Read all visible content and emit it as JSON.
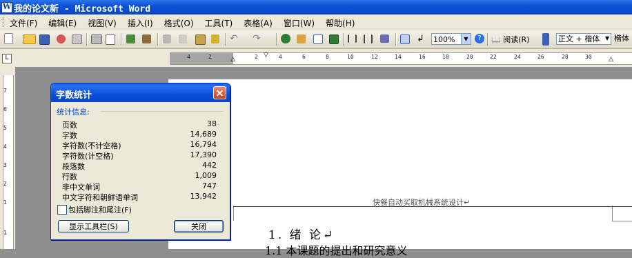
{
  "window": {
    "title": "我的论文新 - Microsoft Word"
  },
  "menu": {
    "items": [
      "文件(F)",
      "编辑(E)",
      "视图(V)",
      "插入(I)",
      "格式(O)",
      "工具(T)",
      "表格(A)",
      "窗口(W)",
      "帮助(H)"
    ]
  },
  "toolbar": {
    "zoom_value": "100%",
    "read_label": "阅读(R)",
    "style_value": "正文 + 楷体",
    "font_value": "楷体",
    "icons": [
      "new-doc-icon",
      "open-folder-icon",
      "save-icon",
      "permission-icon",
      "email-icon",
      "print-icon",
      "print-preview-icon",
      "spelling-icon",
      "research-icon",
      "cut-icon",
      "copy-icon",
      "paste-icon",
      "format-painter-icon",
      "undo-icon",
      "redo-icon",
      "hyperlink-icon",
      "tables-borders-icon",
      "insert-table-icon",
      "insert-excel-icon",
      "columns-icon",
      "drawing-icon",
      "document-map-icon",
      "show-hide-icon",
      "help-icon"
    ]
  },
  "ruler": {
    "h_marks": [
      "4",
      "2",
      "2",
      "4",
      "6",
      "8",
      "10",
      "12",
      "14",
      "16",
      "18",
      "20",
      "22",
      "24",
      "26",
      "28",
      "30"
    ],
    "v_marks": [
      "7",
      "6",
      "5",
      "4",
      "3",
      "2",
      "1",
      "1"
    ]
  },
  "document": {
    "header_text": "快餐自动买取机械系统设计↵",
    "heading1": "1.  绪 论↵",
    "heading2": "1.1 本课题的提出和研究意义"
  },
  "dialog": {
    "title": "字数统计",
    "group_label": "统计信息:",
    "stats": [
      {
        "label": "页数",
        "value": "38"
      },
      {
        "label": "字数",
        "value": "14,689"
      },
      {
        "label": "字符数(不计空格)",
        "value": "16,794"
      },
      {
        "label": "字符数(计空格)",
        "value": "17,390"
      },
      {
        "label": "段落数",
        "value": "442"
      },
      {
        "label": "行数",
        "value": "1,009"
      },
      {
        "label": "非中文单词",
        "value": "747"
      },
      {
        "label": "中文字符和朝鲜语单词",
        "value": "13,942"
      }
    ],
    "checkbox_label": "包括脚注和尾注(F)",
    "show_toolbar_button": "显示工具栏(S)",
    "close_button": "关闭"
  }
}
